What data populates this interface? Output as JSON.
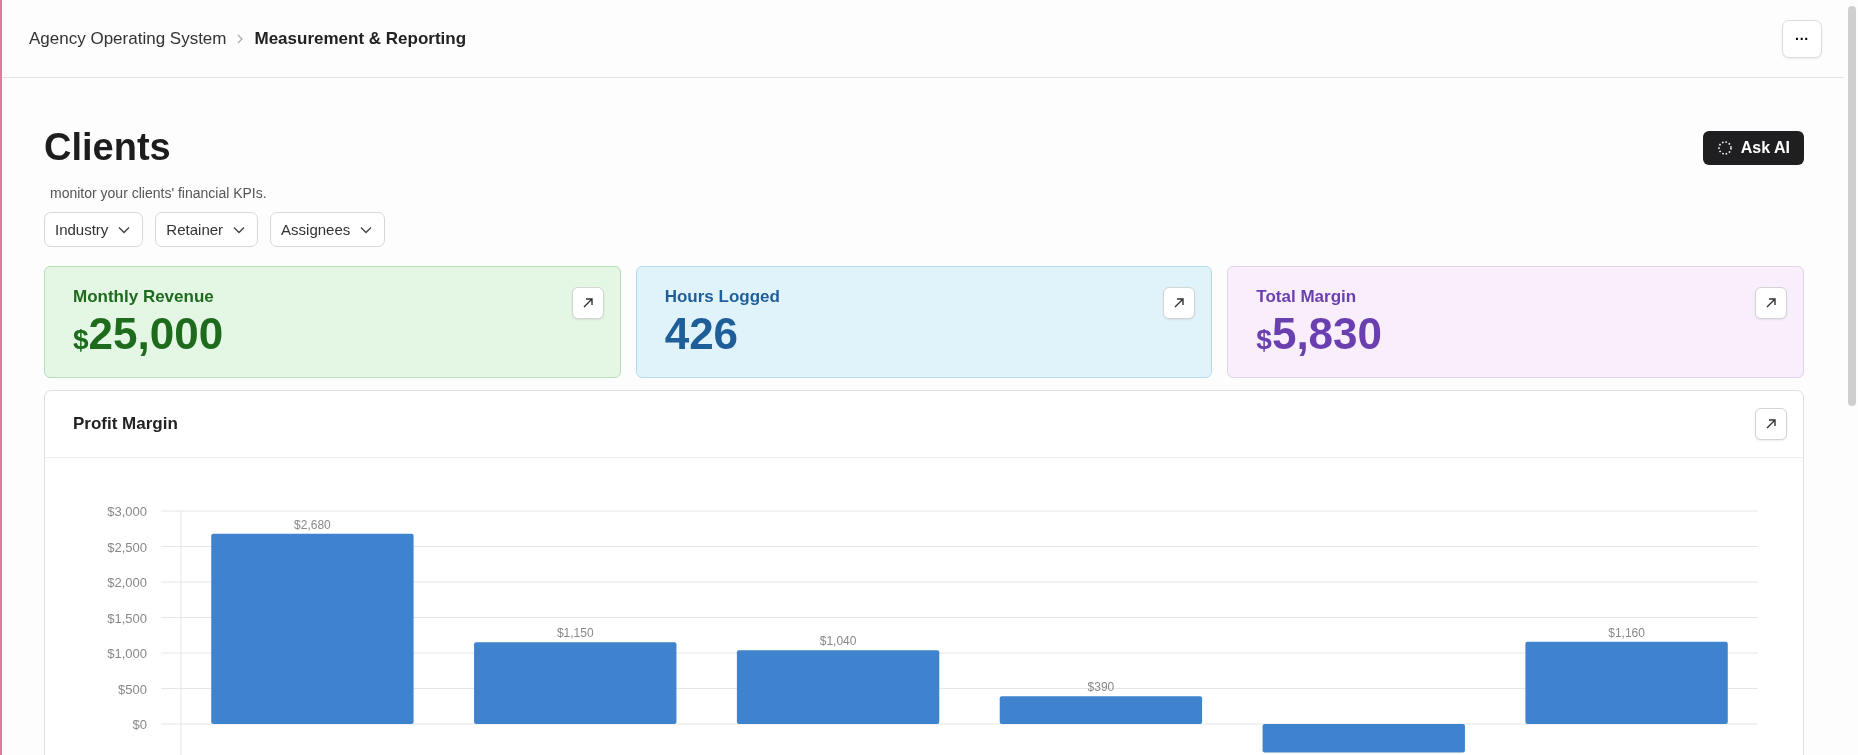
{
  "breadcrumb": [
    {
      "label": "Agency Operating System",
      "current": false
    },
    {
      "label": "Measurement & Reporting",
      "current": true
    }
  ],
  "more_button": {
    "label": "···"
  },
  "page": {
    "title": "Clients",
    "subtitle": "monitor your clients' financial KPIs.",
    "ask_ai": {
      "label": "Ask AI"
    }
  },
  "filters": [
    {
      "label": "Industry"
    },
    {
      "label": "Retainer"
    },
    {
      "label": "Assignees"
    }
  ],
  "kpis": [
    {
      "label": "Monthly Revenue",
      "prefix": "$",
      "value": "25,000",
      "color": "#1e6b1e"
    },
    {
      "label": "Hours Logged",
      "value": "426",
      "color": "#1f5f99"
    },
    {
      "label": "Total Margin",
      "prefix": "$",
      "value": "5,830",
      "color": "#6a3fb0"
    }
  ],
  "profit_margin": {
    "title": "Profit Margin",
    "chart_data": {
      "type": "bar",
      "values": [
        2680,
        1150,
        1040,
        390,
        -400,
        1160
      ],
      "grid": true,
      "ylim": [
        -400,
        3000
      ],
      "yticks": [
        {
          "value": 0,
          "label": "$0"
        },
        {
          "value": 500,
          "label": "$500"
        },
        {
          "value": 1000,
          "label": "$1,000"
        },
        {
          "value": 1500,
          "label": "$1,500"
        },
        {
          "value": 2000,
          "label": "$2,000"
        },
        {
          "value": 2500,
          "label": "$2,500"
        },
        {
          "value": 3000,
          "label": "$3,000"
        }
      ],
      "value_labels": [
        "$2,680",
        "$1,150",
        "$1,040",
        "$390",
        null,
        "$1,160"
      ]
    }
  }
}
